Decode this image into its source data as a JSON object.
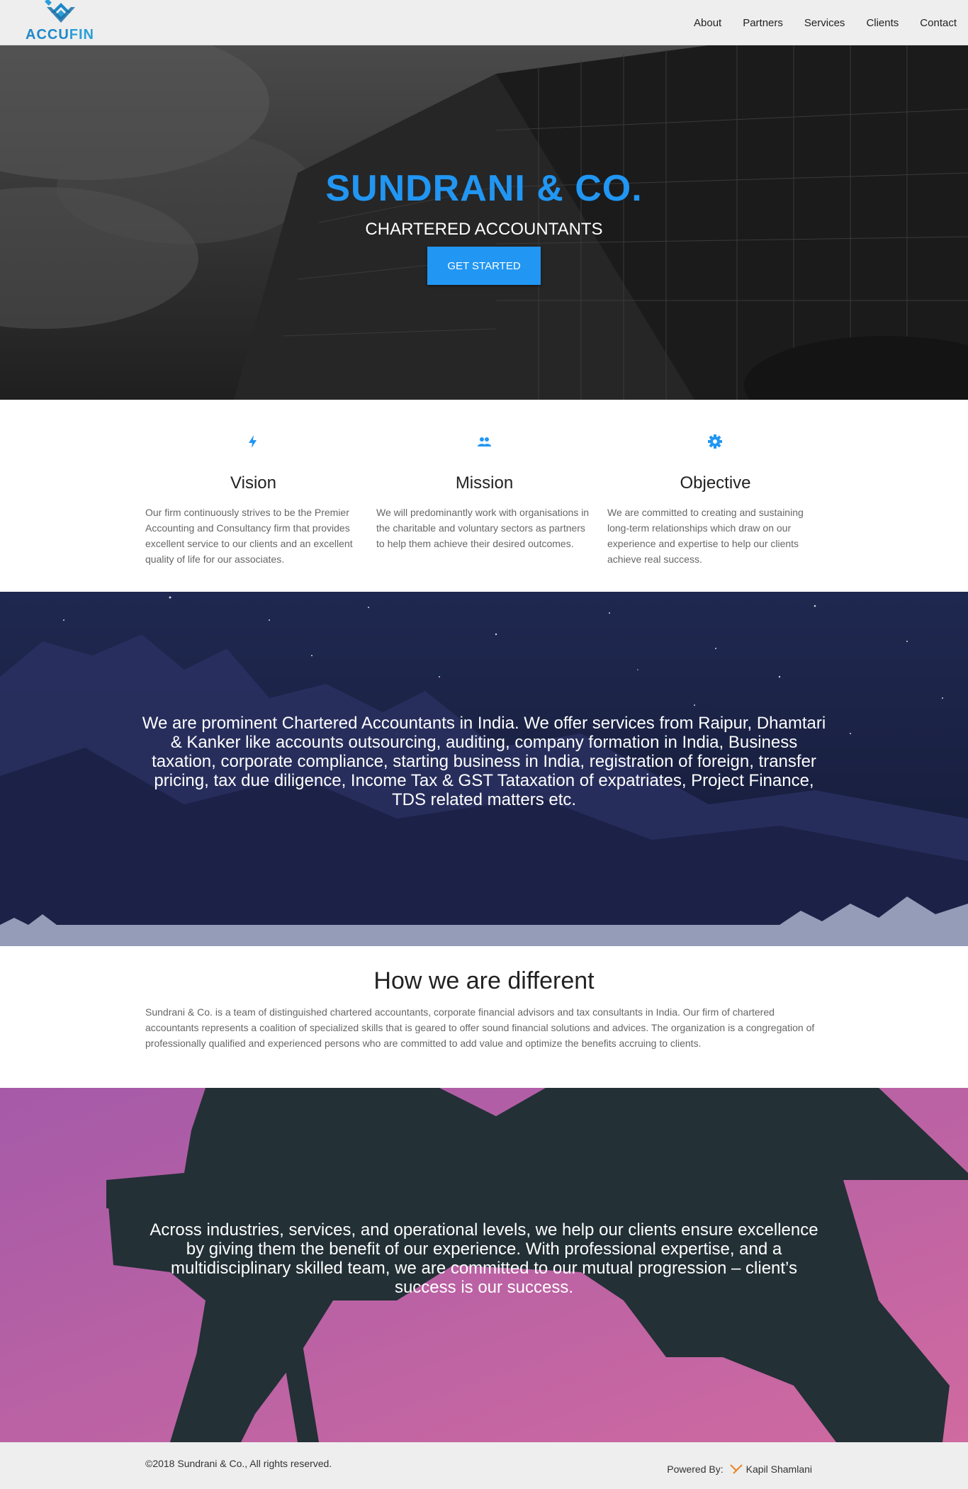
{
  "brand": {
    "logo_prefix": "ACCU",
    "logo_suffix": "FIN",
    "accent": "#2196f3"
  },
  "nav": {
    "items": [
      {
        "label": "About"
      },
      {
        "label": "Partners"
      },
      {
        "label": "Services"
      },
      {
        "label": "Clients"
      },
      {
        "label": "Contact"
      }
    ]
  },
  "hero": {
    "title": "SUNDRANI & CO.",
    "subtitle": "CHARTERED ACCOUNTANTS",
    "button_label": "GET STARTED"
  },
  "features": [
    {
      "icon": "lightning-icon",
      "title": "Vision",
      "text": "Our firm continuously strives to be the Premier Accounting and Consultancy firm that provides excellent service to our clients and an excellent quality of life for our associates."
    },
    {
      "icon": "people-icon",
      "title": "Mission",
      "text": "We will predominantly work with organisations in the charitable and voluntary sectors as partners to help them achieve their desired outcomes."
    },
    {
      "icon": "gear-icon",
      "title": "Objective",
      "text": "We are committed to creating and sustaining long-term relationships which draw on our experience and expertise to help our clients achieve real success."
    }
  ],
  "services_banner": {
    "text": "We are prominent Chartered Accountants in India. We offer services from Raipur, Dhamtari & Kanker like accounts outsourcing, auditing, company formation in India, Business taxation, corporate compliance, starting business in India, registration of foreign, transfer pricing, tax due diligence, Income Tax & GST Tataxation of expatriates, Project Finance, TDS related matters etc."
  },
  "different": {
    "heading": "How we are different",
    "text": "Sundrani & Co. is a team of distinguished chartered accountants, corporate financial advisors and tax consultants in India. Our firm of chartered accountants represents a coalition of specialized skills that is geared to offer sound financial solutions and advices. The organization is a congregation of professionally qualified and experienced persons who are committed to add value and optimize the benefits accruing to clients."
  },
  "experience_banner": {
    "text": "Across industries, services, and operational levels, we help our clients ensure excellence by giving them the benefit of our experience. With professional expertise, and a multidisciplinary skilled team, we are committed to our mutual progression – client’s success is our success."
  },
  "footer": {
    "copyright": "©2018 Sundrani & Co., All rights reserved.",
    "powered_by": "Powered By:",
    "author": "Kapil Shamlani"
  }
}
